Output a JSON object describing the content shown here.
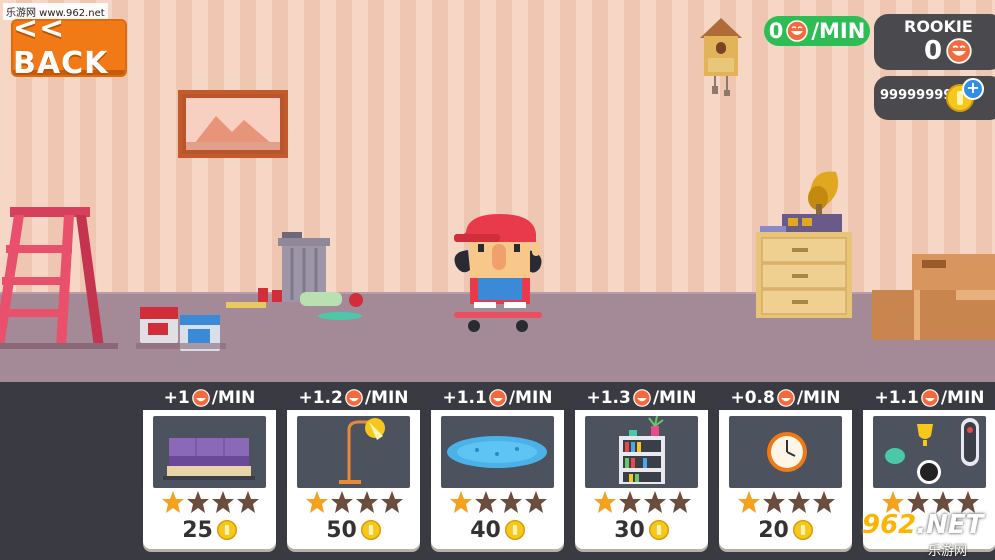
{
  "watermark": {
    "site": "乐游网 www.962.net",
    "logo_main": "962",
    "logo_net": ".NET",
    "logo_sub": "乐游网"
  },
  "back_button": {
    "label": "<< BACK"
  },
  "hud": {
    "rate": {
      "value": "0",
      "unit": "/MIN"
    },
    "level": {
      "label": "ROOKIE",
      "count": "0"
    },
    "coins": {
      "amount": "99999999",
      "add_label": "+"
    }
  },
  "shop": {
    "items": [
      {
        "rate": "+1",
        "unit": "/MIN",
        "item": "sofa-icon",
        "price": "25",
        "stars_filled": 1,
        "stars_total": 4
      },
      {
        "rate": "+1.2",
        "unit": "/MIN",
        "item": "lamp-icon",
        "price": "50",
        "stars_filled": 1,
        "stars_total": 4
      },
      {
        "rate": "+1.1",
        "unit": "/MIN",
        "item": "rug-icon",
        "price": "40",
        "stars_filled": 1,
        "stars_total": 4
      },
      {
        "rate": "+1.3",
        "unit": "/MIN",
        "item": "bookshelf-icon",
        "price": "30",
        "stars_filled": 1,
        "stars_total": 4
      },
      {
        "rate": "+0.8",
        "unit": "/MIN",
        "item": "wall-clock-icon",
        "price": "20",
        "stars_filled": 1,
        "stars_total": 4
      },
      {
        "rate": "+1.1",
        "unit": "/MIN",
        "item": "trophy-decor-icon",
        "price": "",
        "stars_filled": 1,
        "stars_total": 4
      }
    ]
  },
  "colors": {
    "accent_orange": "#f27a16",
    "rate_green": "#2ebd54",
    "panel_dark": "#4a4a4e",
    "wall": "#f6d7c5",
    "floor": "#a48997",
    "star_filled": "#f3a21f",
    "star_empty": "#6b4d3e",
    "coin": "#f6c81c"
  }
}
